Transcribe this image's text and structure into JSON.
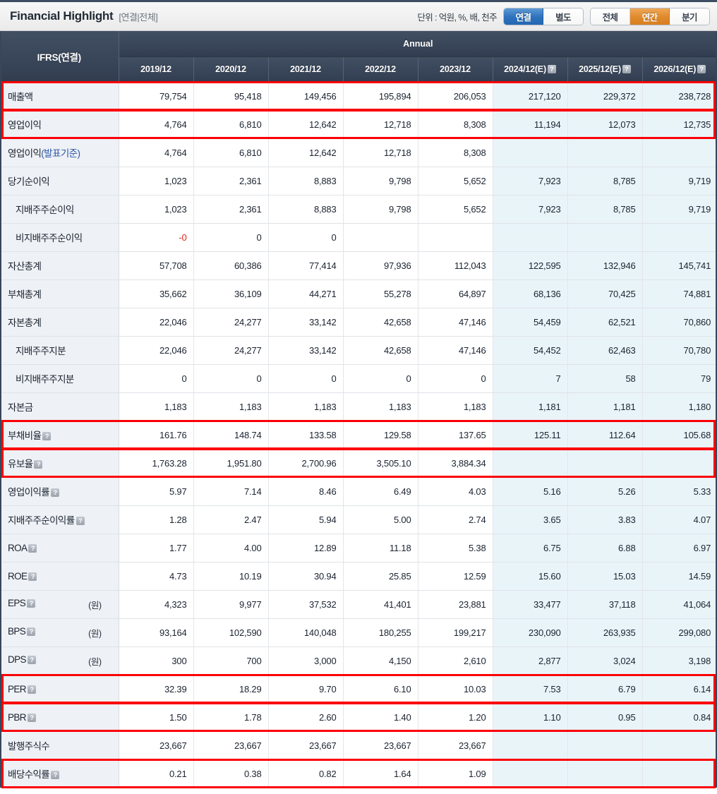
{
  "header": {
    "title": "Financial Highlight",
    "subtitle": "[연결|전체]",
    "unit_note": "단위 : 억원, %, 배, 천주",
    "scope_toggle": {
      "options": [
        "연결",
        "별도"
      ],
      "selected": "연결"
    },
    "period_toggle": {
      "options": [
        "전체",
        "연간",
        "분기"
      ],
      "selected": "연간"
    }
  },
  "table": {
    "row_header": "IFRS(연결)",
    "group_label": "Annual",
    "columns": [
      {
        "label": "2019/12",
        "estimate": false
      },
      {
        "label": "2020/12",
        "estimate": false
      },
      {
        "label": "2021/12",
        "estimate": false
      },
      {
        "label": "2022/12",
        "estimate": false
      },
      {
        "label": "2023/12",
        "estimate": false
      },
      {
        "label": "2024/12(E)",
        "estimate": true,
        "help": "?"
      },
      {
        "label": "2025/12(E)",
        "estimate": true,
        "help": "?"
      },
      {
        "label": "2026/12(E)",
        "estimate": true,
        "help": "?"
      }
    ],
    "rows": [
      {
        "label": "매출액",
        "indent": false,
        "help": false,
        "unit": "",
        "highlight": true,
        "values": [
          "79,754",
          "95,418",
          "149,456",
          "195,894",
          "206,053",
          "217,120",
          "229,372",
          "238,728"
        ]
      },
      {
        "label": "영업이익",
        "indent": false,
        "help": false,
        "unit": "",
        "highlight": true,
        "values": [
          "4,764",
          "6,810",
          "12,642",
          "12,718",
          "8,308",
          "11,194",
          "12,073",
          "12,735"
        ]
      },
      {
        "label": "영업이익(발표기준)",
        "indent": false,
        "help": false,
        "unit": "",
        "highlight": false,
        "values": [
          "4,764",
          "6,810",
          "12,642",
          "12,718",
          "8,308",
          "",
          "",
          ""
        ]
      },
      {
        "label": "당기순이익",
        "indent": false,
        "help": false,
        "unit": "",
        "highlight": false,
        "values": [
          "1,023",
          "2,361",
          "8,883",
          "9,798",
          "5,652",
          "7,923",
          "8,785",
          "9,719"
        ]
      },
      {
        "label": "지배주주순이익",
        "indent": true,
        "help": false,
        "unit": "",
        "highlight": false,
        "values": [
          "1,023",
          "2,361",
          "8,883",
          "9,798",
          "5,652",
          "7,923",
          "8,785",
          "9,719"
        ]
      },
      {
        "label": "비지배주주순이익",
        "indent": true,
        "help": false,
        "unit": "",
        "highlight": false,
        "values": [
          "-0",
          "0",
          "0",
          "",
          "",
          "",
          "",
          ""
        ],
        "negative_idx": [
          0
        ]
      },
      {
        "label": "자산총계",
        "indent": false,
        "help": false,
        "unit": "",
        "highlight": false,
        "values": [
          "57,708",
          "60,386",
          "77,414",
          "97,936",
          "112,043",
          "122,595",
          "132,946",
          "145,741"
        ]
      },
      {
        "label": "부채총계",
        "indent": false,
        "help": false,
        "unit": "",
        "highlight": false,
        "values": [
          "35,662",
          "36,109",
          "44,271",
          "55,278",
          "64,897",
          "68,136",
          "70,425",
          "74,881"
        ]
      },
      {
        "label": "자본총계",
        "indent": false,
        "help": false,
        "unit": "",
        "highlight": false,
        "values": [
          "22,046",
          "24,277",
          "33,142",
          "42,658",
          "47,146",
          "54,459",
          "62,521",
          "70,860"
        ]
      },
      {
        "label": "지배주주지분",
        "indent": true,
        "help": false,
        "unit": "",
        "highlight": false,
        "values": [
          "22,046",
          "24,277",
          "33,142",
          "42,658",
          "47,146",
          "54,452",
          "62,463",
          "70,780"
        ]
      },
      {
        "label": "비지배주주지분",
        "indent": true,
        "help": false,
        "unit": "",
        "highlight": false,
        "values": [
          "0",
          "0",
          "0",
          "0",
          "0",
          "7",
          "58",
          "79"
        ]
      },
      {
        "label": "자본금",
        "indent": false,
        "help": false,
        "unit": "",
        "highlight": false,
        "values": [
          "1,183",
          "1,183",
          "1,183",
          "1,183",
          "1,183",
          "1,181",
          "1,181",
          "1,180"
        ]
      },
      {
        "label": "부채비율",
        "indent": false,
        "help": true,
        "unit": "",
        "highlight": true,
        "values": [
          "161.76",
          "148.74",
          "133.58",
          "129.58",
          "137.65",
          "125.11",
          "112.64",
          "105.68"
        ]
      },
      {
        "label": "유보율",
        "indent": false,
        "help": true,
        "unit": "",
        "highlight": true,
        "values": [
          "1,763.28",
          "1,951.80",
          "2,700.96",
          "3,505.10",
          "3,884.34",
          "",
          "",
          ""
        ]
      },
      {
        "label": "영업이익률",
        "indent": false,
        "help": true,
        "unit": "",
        "highlight": false,
        "values": [
          "5.97",
          "7.14",
          "8.46",
          "6.49",
          "4.03",
          "5.16",
          "5.26",
          "5.33"
        ]
      },
      {
        "label": "지배주주순이익률",
        "indent": false,
        "help": true,
        "unit": "",
        "highlight": false,
        "values": [
          "1.28",
          "2.47",
          "5.94",
          "5.00",
          "2.74",
          "3.65",
          "3.83",
          "4.07"
        ]
      },
      {
        "label": "ROA",
        "indent": false,
        "help": true,
        "unit": "",
        "highlight": false,
        "values": [
          "1.77",
          "4.00",
          "12.89",
          "11.18",
          "5.38",
          "6.75",
          "6.88",
          "6.97"
        ]
      },
      {
        "label": "ROE",
        "indent": false,
        "help": true,
        "unit": "",
        "highlight": false,
        "values": [
          "4.73",
          "10.19",
          "30.94",
          "25.85",
          "12.59",
          "15.60",
          "15.03",
          "14.59"
        ]
      },
      {
        "label": "EPS",
        "indent": false,
        "help": true,
        "unit": "(원)",
        "highlight": false,
        "values": [
          "4,323",
          "9,977",
          "37,532",
          "41,401",
          "23,881",
          "33,477",
          "37,118",
          "41,064"
        ]
      },
      {
        "label": "BPS",
        "indent": false,
        "help": true,
        "unit": "(원)",
        "highlight": false,
        "values": [
          "93,164",
          "102,590",
          "140,048",
          "180,255",
          "199,217",
          "230,090",
          "263,935",
          "299,080"
        ]
      },
      {
        "label": "DPS",
        "indent": false,
        "help": true,
        "unit": "(원)",
        "highlight": false,
        "values": [
          "300",
          "700",
          "3,000",
          "4,150",
          "2,610",
          "2,877",
          "3,024",
          "3,198"
        ]
      },
      {
        "label": "PER",
        "indent": false,
        "help": true,
        "unit": "",
        "highlight": true,
        "values": [
          "32.39",
          "18.29",
          "9.70",
          "6.10",
          "10.03",
          "7.53",
          "6.79",
          "6.14"
        ]
      },
      {
        "label": "PBR",
        "indent": false,
        "help": true,
        "unit": "",
        "highlight": true,
        "values": [
          "1.50",
          "1.78",
          "2.60",
          "1.40",
          "1.20",
          "1.10",
          "0.95",
          "0.84"
        ]
      },
      {
        "label": "발행주식수",
        "indent": false,
        "help": false,
        "unit": "",
        "highlight": false,
        "values": [
          "23,667",
          "23,667",
          "23,667",
          "23,667",
          "23,667",
          "",
          "",
          ""
        ]
      },
      {
        "label": "배당수익률",
        "indent": false,
        "help": true,
        "unit": "",
        "highlight": true,
        "values": [
          "0.21",
          "0.38",
          "0.82",
          "1.64",
          "1.09",
          "",
          "",
          ""
        ]
      }
    ]
  },
  "colors": {
    "header_bg": "#39465a",
    "accent_blue": "#2f72bd",
    "accent_orange": "#e08a2c",
    "highlight_red": "#fb0007",
    "estimate_bg": "#e9f4f9",
    "label_bg": "#eef1f5",
    "negative_text": "#e2231a"
  }
}
